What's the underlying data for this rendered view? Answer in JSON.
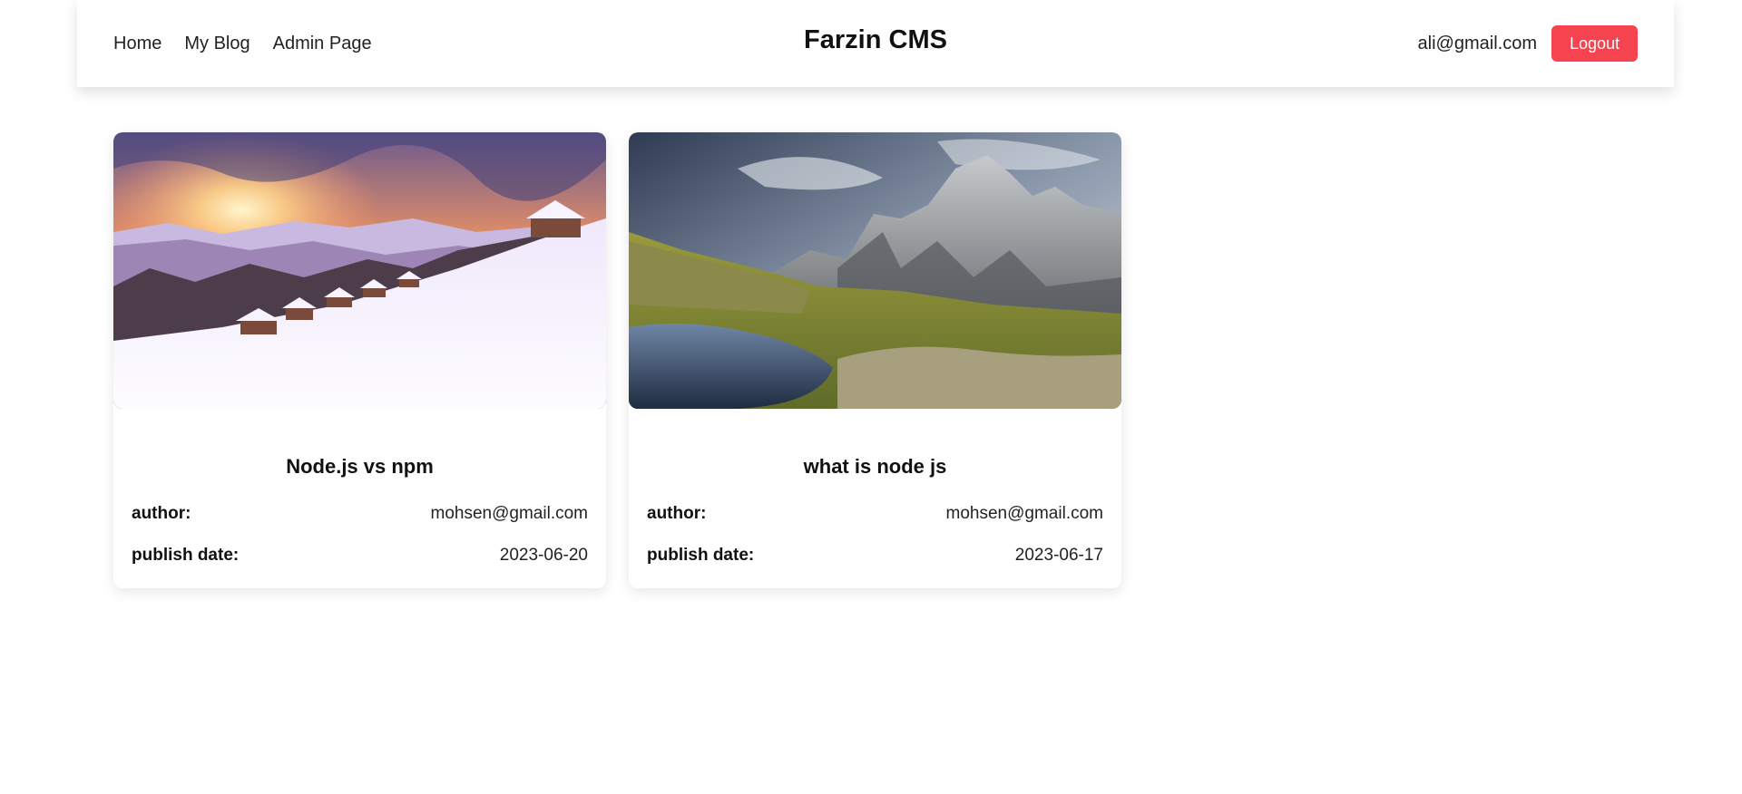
{
  "header": {
    "nav": [
      {
        "label": "Home"
      },
      {
        "label": "My Blog"
      },
      {
        "label": "Admin Page"
      }
    ],
    "brand": "Farzin CMS",
    "user_email": "ali@gmail.com",
    "logout_label": "Logout",
    "logout_color": "#f5444f"
  },
  "posts": [
    {
      "title": "Node.js vs npm",
      "author_label": "author:",
      "author": "mohsen@gmail.com",
      "date_label": "publish date:",
      "date": "2023-06-20",
      "image": "snowy-mountain-sunset-cabins"
    },
    {
      "title": "what is node js",
      "author_label": "author:",
      "author": "mohsen@gmail.com",
      "date_label": "publish date:",
      "date": "2023-06-17",
      "image": "rocky-mountain-lake-valley"
    }
  ]
}
